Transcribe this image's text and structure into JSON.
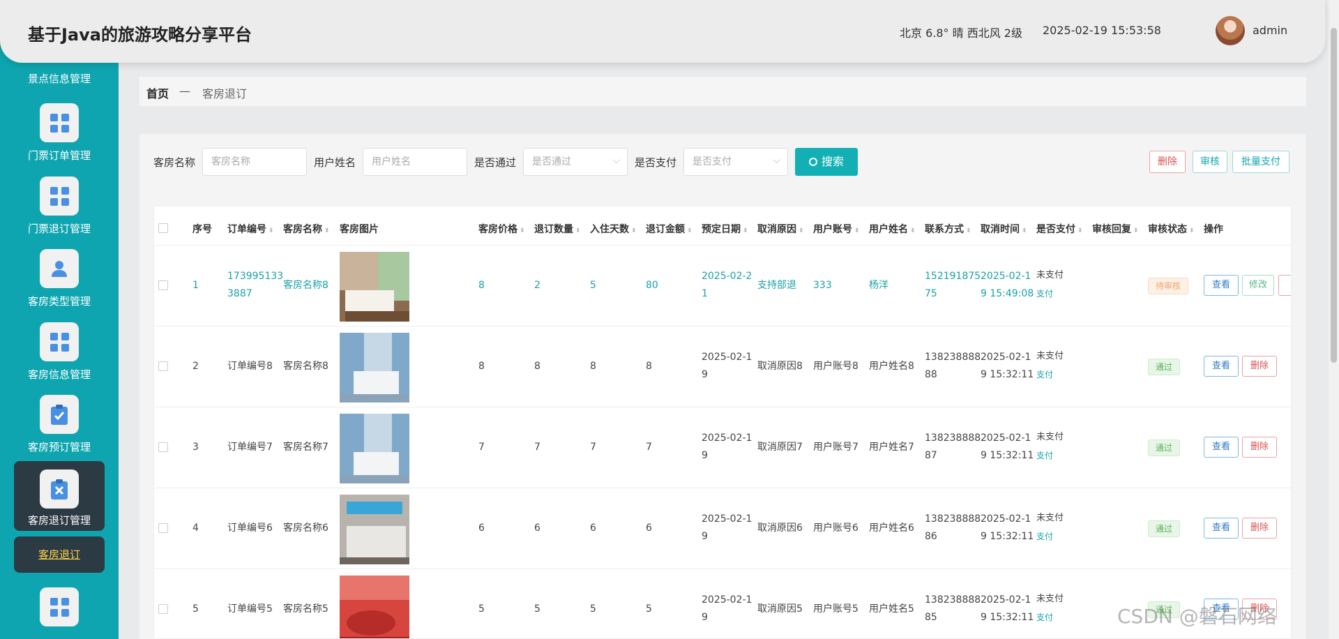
{
  "header": {
    "title": "基于Java的旅游攻略分享平台",
    "weather": "北京  6.8°  晴  西北风  2级",
    "datetime": "2025-02-19 15:53:58",
    "username": "admin"
  },
  "sidebar": {
    "cut_label": "景点信息管理",
    "items": [
      {
        "label": "门票订单管理",
        "icon": "grid-icon"
      },
      {
        "label": "门票退订管理",
        "icon": "grid-icon"
      },
      {
        "label": "客房类型管理",
        "icon": "person-icon"
      },
      {
        "label": "客房信息管理",
        "icon": "grid-icon"
      },
      {
        "label": "客房预订管理",
        "icon": "clipboard-check-icon"
      },
      {
        "label": "客房退订管理",
        "icon": "clipboard-x-icon"
      }
    ],
    "sub_item": "客房退订"
  },
  "breadcrumb": {
    "home": "首页",
    "sep": "—",
    "current": "客房退订"
  },
  "filters": {
    "room_name_label": "客房名称",
    "room_name_placeholder": "客房名称",
    "user_name_label": "用户姓名",
    "user_name_placeholder": "用户姓名",
    "approved_label": "是否通过",
    "approved_placeholder": "是否通过",
    "paid_label": "是否支付",
    "paid_placeholder": "是否支付",
    "search_label": "搜索"
  },
  "actions": {
    "delete": "删除",
    "audit": "审核",
    "batch_pay": "批量支付"
  },
  "table": {
    "headers": [
      "序号",
      "订单编号",
      "客房名称",
      "客房图片",
      "客房价格",
      "退订数量",
      "入住天数",
      "退订金额",
      "预定日期",
      "取消原因",
      "用户账号",
      "用户姓名",
      "联系方式",
      "取消时间",
      "是否支付",
      "审核回复",
      "审核状态",
      "操作"
    ],
    "rows": [
      {
        "no": "1",
        "order_l1": "173995133",
        "order_l2": "3887",
        "room": "客房名称8",
        "price": "8",
        "qty": "2",
        "days": "5",
        "amount": "80",
        "date_l1": "2025-02-2",
        "date_l2": "1",
        "reason": "支持部退",
        "account": "333",
        "name": "杨洋",
        "phone_l1": "152191875",
        "phone_l2": "75",
        "ctime_l1": "2025-02-1",
        "ctime_l2": "9 15:49:08",
        "pay_status": "未支付",
        "pay_link": "支付",
        "status": "待审核",
        "view": "查看",
        "edit": "修改"
      },
      {
        "no": "2",
        "order_l1": "订单编号8",
        "order_l2": "",
        "room": "客房名称8",
        "price": "8",
        "qty": "8",
        "days": "8",
        "amount": "8",
        "date_l1": "2025-02-1",
        "date_l2": "9",
        "reason": "取消原因8",
        "account": "用户账号8",
        "name": "用户姓名8",
        "phone_l1": "138238888",
        "phone_l2": "88",
        "ctime_l1": "2025-02-1",
        "ctime_l2": "9 15:32:11",
        "pay_status": "未支付",
        "pay_link": "支付",
        "status": "通过",
        "view": "查看",
        "del": "删除"
      },
      {
        "no": "3",
        "order_l1": "订单编号7",
        "order_l2": "",
        "room": "客房名称7",
        "price": "7",
        "qty": "7",
        "days": "7",
        "amount": "7",
        "date_l1": "2025-02-1",
        "date_l2": "9",
        "reason": "取消原因7",
        "account": "用户账号7",
        "name": "用户姓名7",
        "phone_l1": "138238888",
        "phone_l2": "87",
        "ctime_l1": "2025-02-1",
        "ctime_l2": "9 15:32:11",
        "pay_status": "未支付",
        "pay_link": "支付",
        "status": "通过",
        "view": "查看",
        "del": "删除"
      },
      {
        "no": "4",
        "order_l1": "订单编号6",
        "order_l2": "",
        "room": "客房名称6",
        "price": "6",
        "qty": "6",
        "days": "6",
        "amount": "6",
        "date_l1": "2025-02-1",
        "date_l2": "9",
        "reason": "取消原因6",
        "account": "用户账号6",
        "name": "用户姓名6",
        "phone_l1": "138238888",
        "phone_l2": "86",
        "ctime_l1": "2025-02-1",
        "ctime_l2": "9 15:32:11",
        "pay_status": "未支付",
        "pay_link": "支付",
        "status": "通过",
        "view": "查看",
        "del": "删除"
      },
      {
        "no": "5",
        "order_l1": "订单编号5",
        "order_l2": "",
        "room": "客房名称5",
        "price": "5",
        "qty": "5",
        "days": "5",
        "amount": "5",
        "date_l1": "2025-02-1",
        "date_l2": "9",
        "reason": "取消原因5",
        "account": "用户账号5",
        "name": "用户姓名5",
        "phone_l1": "138238888",
        "phone_l2": "85",
        "ctime_l1": "2025-02-1",
        "ctime_l2": "9 15:32:11",
        "pay_status": "未支付",
        "pay_link": "支付",
        "status": "通过",
        "view": "查看",
        "del": "删除"
      }
    ]
  },
  "watermark": "CSDN @磐石网络",
  "colors": {
    "sidebar": "#0ea5b0",
    "accent": "#12b0b4",
    "active": "#2c3a44",
    "teal_text": "#1aa0a8"
  }
}
